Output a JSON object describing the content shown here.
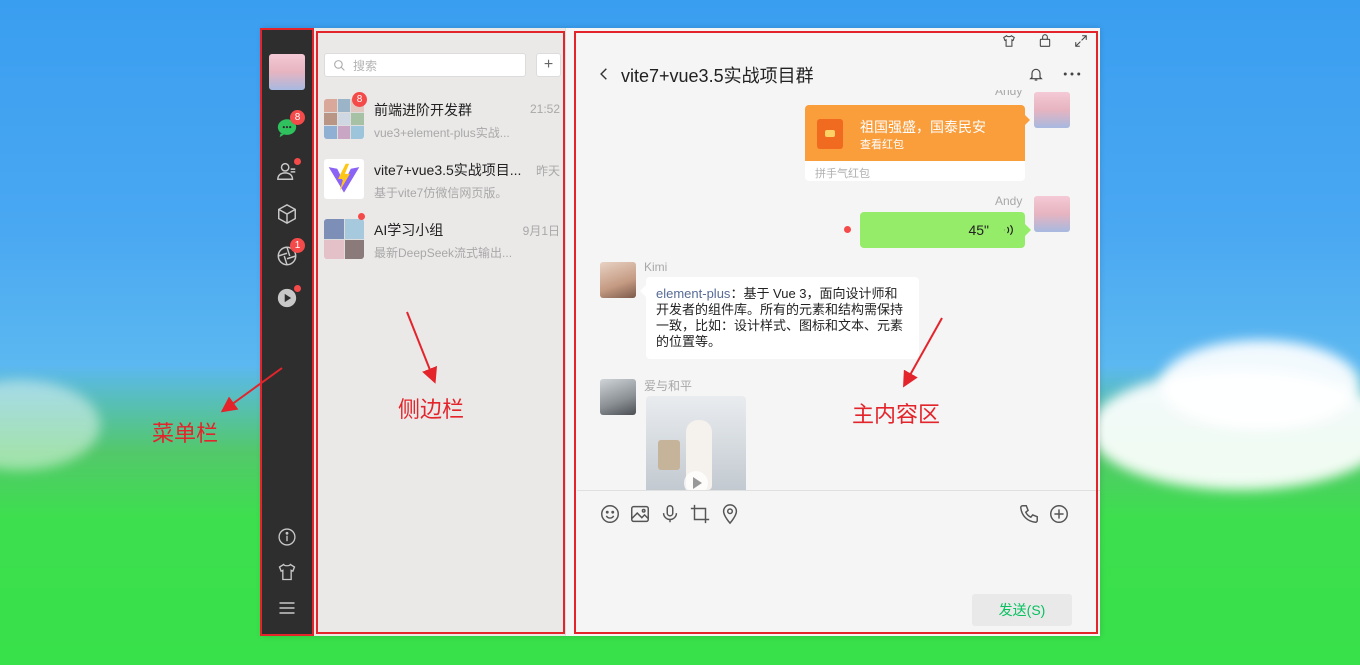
{
  "menubar": {
    "badges": {
      "chat": "8",
      "moments": "1"
    },
    "annotation": "菜单栏"
  },
  "sidebar": {
    "search_placeholder": "搜索",
    "add_label": "+",
    "annotation": "侧边栏",
    "chats": [
      {
        "name": "前端进阶开发群",
        "time": "21:52",
        "last": "vue3+element-plus实战...",
        "badge": "8"
      },
      {
        "name": "vite7+vue3.5实战项目...",
        "time": "昨天",
        "last": "基于vite7仿微信网页版。"
      },
      {
        "name": "AI学习小组",
        "time": "9月1日",
        "last": "最新DeepSeek流式输出..."
      }
    ]
  },
  "main": {
    "title": "vite7+vue3.5实战项目群",
    "annotation": "主内容区",
    "messages": {
      "andy_name_1": "Andy",
      "redpacket_title": "祖国强盛，国泰民安",
      "redpacket_sub": "查看红包",
      "redpacket_footer": "拼手气红包",
      "andy_name_2": "Andy",
      "voice_duration": "45\"",
      "kimi_name": "Kimi",
      "kimi_link": "element-plus",
      "kimi_text": "：基于 Vue 3，面向设计师和开发者的组件库。所有的元素和结构需保持一致，比如：设计样式、图标和文本、元素的位置等。",
      "peace_name": "爱与和平"
    },
    "send_label": "发送(S)"
  },
  "colors": {
    "accent": "#07c160",
    "redpacket": "#fa9d3b",
    "voice": "#95ec69",
    "highlight": "#e3242b",
    "badge": "#f54a4a"
  }
}
